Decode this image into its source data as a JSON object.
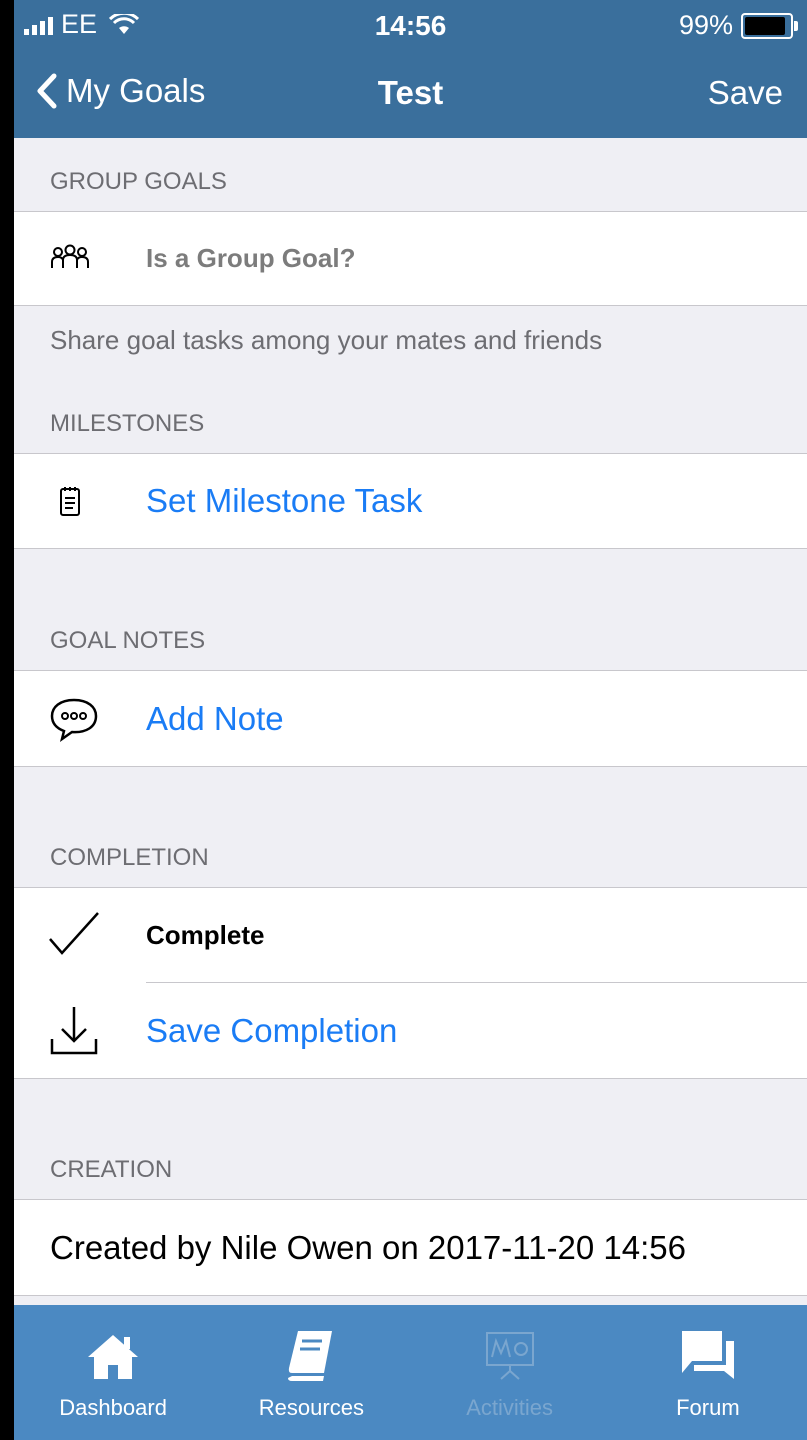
{
  "status_bar": {
    "carrier": "EE",
    "time": "14:56",
    "battery": "99%"
  },
  "nav": {
    "back_label": "My Goals",
    "title": "Test",
    "save_label": "Save"
  },
  "sections": {
    "group_goals": {
      "header": "GROUP GOALS",
      "row_label": "Is a Group Goal?",
      "footer": "Share goal tasks among your mates and friends",
      "icon": "group-icon"
    },
    "milestones": {
      "header": "MILESTONES",
      "row_label": "Set Milestone Task",
      "icon": "notepad-icon"
    },
    "goal_notes": {
      "header": "GOAL NOTES",
      "row_label": "Add Note",
      "icon": "speech-bubble-icon"
    },
    "completion": {
      "header": "COMPLETION",
      "complete_label": "Complete",
      "save_label": "Save Completion",
      "complete_icon": "checkmark-icon",
      "save_icon": "download-icon"
    },
    "creation": {
      "header": "CREATION",
      "text": "Created by Nile Owen on 2017-11-20 14:56"
    }
  },
  "tab_bar": {
    "items": [
      {
        "label": "Dashboard",
        "icon": "home-icon"
      },
      {
        "label": "Resources",
        "icon": "book-icon"
      },
      {
        "label": "Activities",
        "icon": "presentation-icon"
      },
      {
        "label": "Forum",
        "icon": "chat-icon"
      }
    ]
  },
  "colors": {
    "nav_bar": "#3a6f9c",
    "tab_bar": "#4b89c2",
    "link_blue": "#1a7cf5",
    "background": "#efeff4"
  }
}
